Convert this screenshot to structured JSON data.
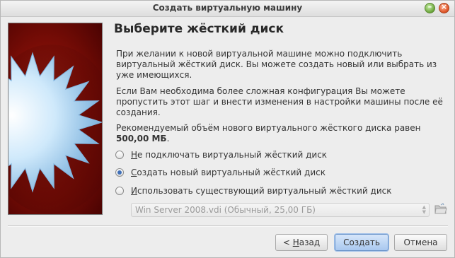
{
  "window": {
    "title": "Создать виртуальную машину",
    "controls": {
      "minimize_glyph": "–",
      "close_glyph": "×"
    }
  },
  "page": {
    "heading": "Выберите жёсткий диск",
    "paragraph1": "При желании к новой виртуальной машине можно подключить виртуальный жёсткий диск. Вы можете создать новый или выбрать из уже имеющихся.",
    "paragraph2": "Если Вам необходима более сложная конфигурация Вы можете пропустить этот шаг и внести изменения в настройки машины после её создания.",
    "paragraph3_prefix": "Рекомендуемый объём нового виртуального жёсткого диска равен ",
    "paragraph3_size": "500,00 МБ",
    "paragraph3_suffix": "."
  },
  "options": [
    {
      "mnemonic": "Н",
      "rest": "е подключать виртуальный жёсткий диск",
      "checked": false
    },
    {
      "mnemonic": "С",
      "rest": "оздать новый виртуальный жёсткий диск",
      "checked": true
    },
    {
      "mnemonic": "И",
      "rest": "спользовать существующий виртуальный жёсткий диск",
      "checked": false
    }
  ],
  "existing_disk": {
    "selected": "Win Server 2008.vdi (Обычный, 25,00 ГБ)",
    "enabled": false
  },
  "buttons": {
    "back_prefix": "< ",
    "back_mnemonic": "Н",
    "back_rest": "азад",
    "create": "Создать",
    "cancel": "Отмена"
  },
  "icons": {
    "banner": "starburst-banner-icon",
    "folder": "folder-open-icon",
    "combo_arrows": "updown-arrows-icon"
  },
  "colors": {
    "banner_red": "#8a120a",
    "star_blue": "#9fd0f2",
    "radio_accent": "#3f6fb7",
    "default_button": "#a9c8ef"
  }
}
